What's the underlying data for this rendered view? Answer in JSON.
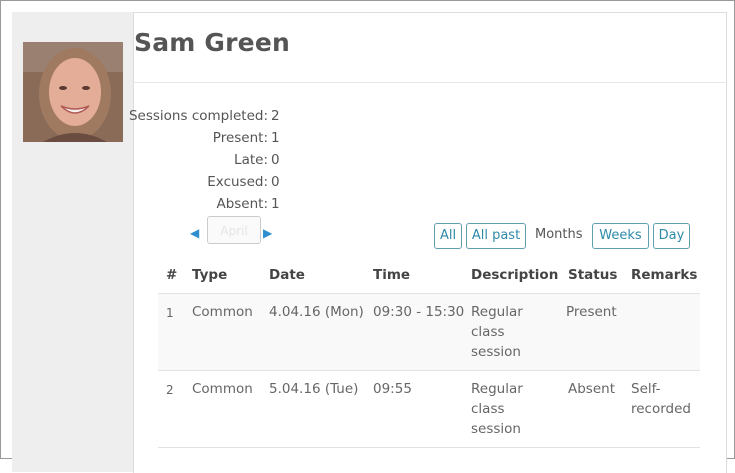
{
  "user": {
    "name": "Sam Green"
  },
  "stats": [
    {
      "label": "Sessions completed:",
      "value": "2"
    },
    {
      "label": "Present:",
      "value": "1"
    },
    {
      "label": "Late:",
      "value": "0"
    },
    {
      "label": "Excused:",
      "value": "0"
    },
    {
      "label": "Absent:",
      "value": "1"
    }
  ],
  "nav": {
    "month": "April",
    "views": {
      "all": "All",
      "all_past": "All past",
      "months": "Months",
      "weeks": "Weeks",
      "day": "Day"
    }
  },
  "table": {
    "headers": [
      "#",
      "Type",
      "Date",
      "Time",
      "Description",
      "Status",
      "Remarks"
    ],
    "rows": [
      {
        "num": "1",
        "type": "Common",
        "date": "4.04.16 (Mon)",
        "time": "09:30 - 15:30",
        "description": "Regular class session",
        "status": "Present",
        "remarks": ""
      },
      {
        "num": "2",
        "type": "Common",
        "date": "5.04.16 (Tue)",
        "time": "09:55",
        "description": "Regular class session",
        "status": "Absent",
        "remarks": "Self-recorded"
      }
    ]
  },
  "colors": {
    "link": "#2f8aa8",
    "sidebar_bg": "#eeeeee",
    "row_alt_bg": "#f9f9f9"
  }
}
